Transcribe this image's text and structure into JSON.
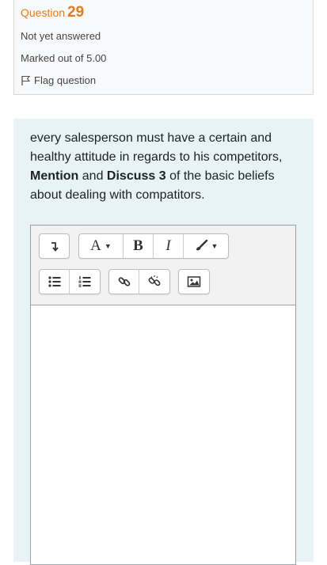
{
  "question": {
    "label": "Question",
    "number": "29",
    "status": "Not yet answered",
    "marks": "Marked out of 5.00",
    "flag_label": "Flag question"
  },
  "question_text": {
    "part1": "every salesperson must have a certain and healthy attitude in regards to his competitors, ",
    "bold1": "Mention",
    "part2": " and ",
    "bold2": "Discuss 3",
    "part3": " of the basic beliefs about dealing with compatitors."
  },
  "toolbar": {
    "font_label": "A",
    "bold_label": "B",
    "italic_label": "I"
  },
  "colors": {
    "accent_orange": "#e07c1f",
    "content_bg": "#e7f3f5",
    "top_bar_red": "#c9544b"
  }
}
